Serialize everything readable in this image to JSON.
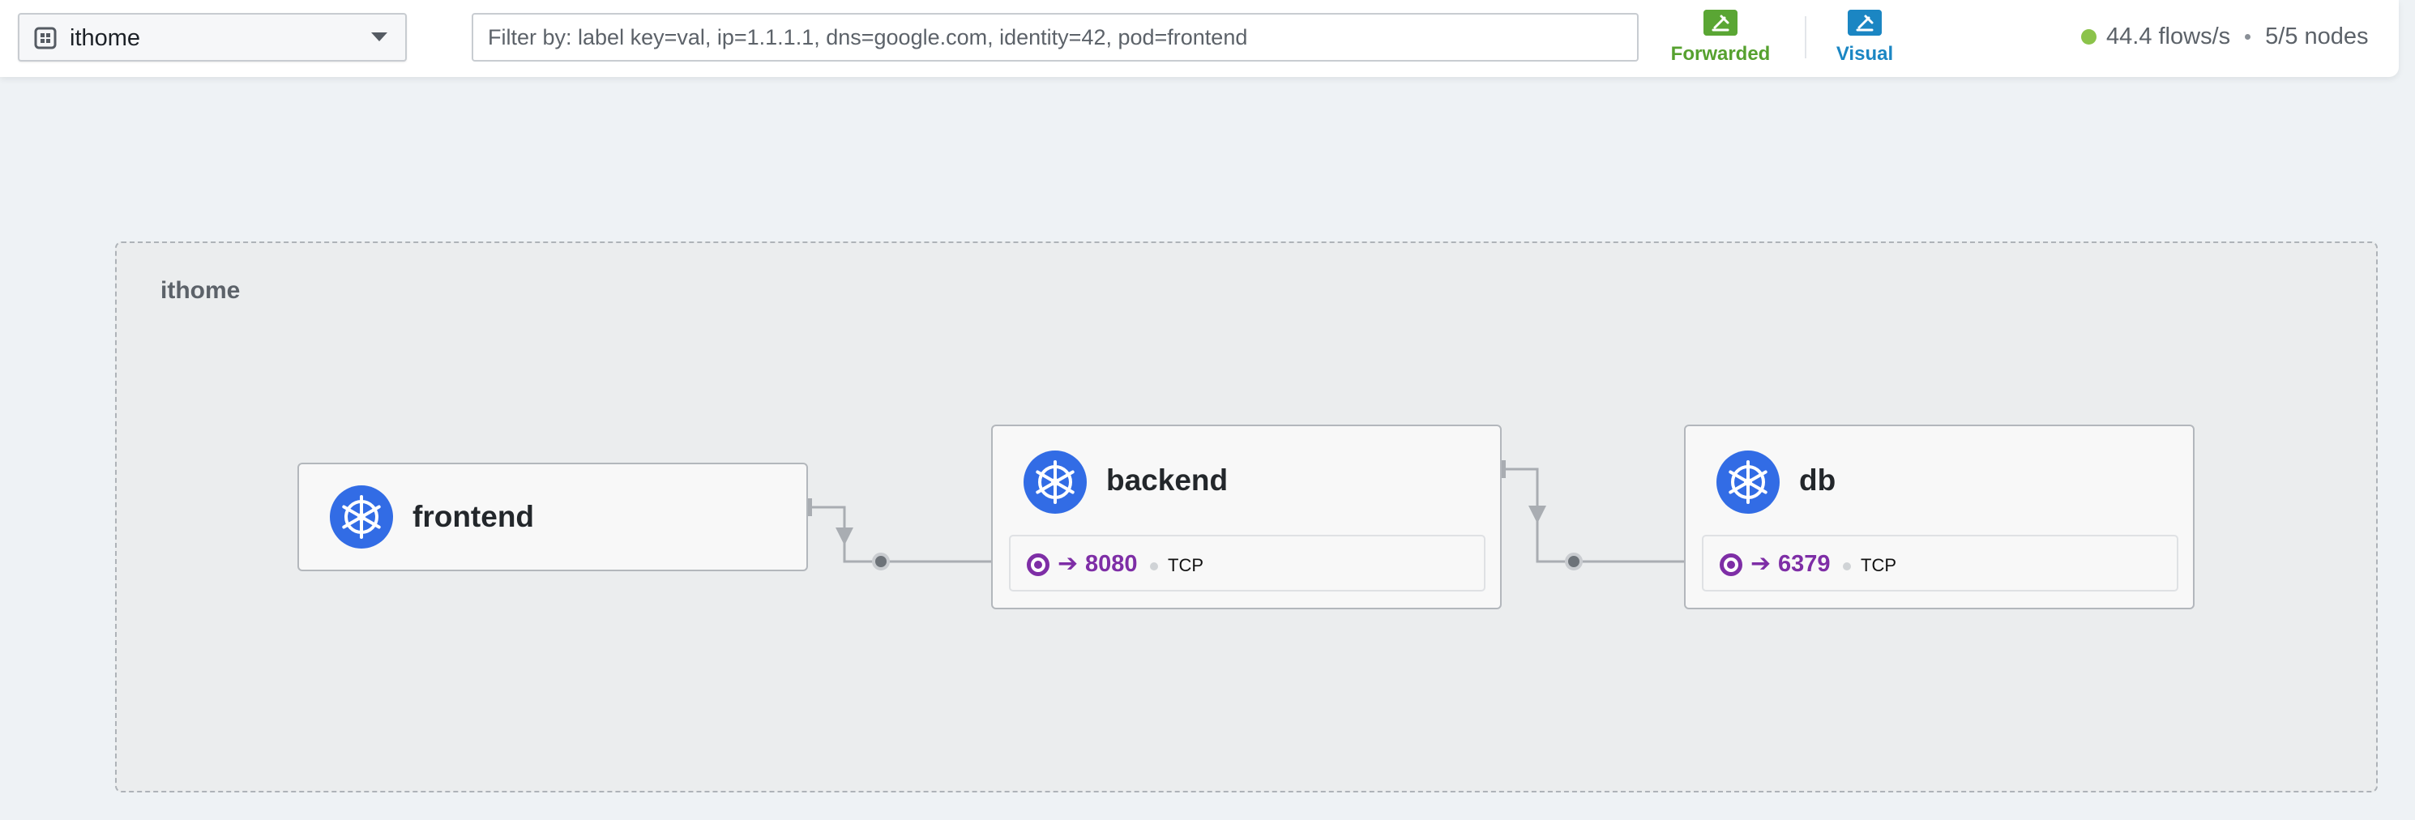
{
  "namespace_selector": {
    "selected": "ithome"
  },
  "filter": {
    "placeholder": "Filter by: label key=val, ip=1.1.1.1, dns=google.com, identity=42, pod=frontend",
    "value": ""
  },
  "verdicts": {
    "forwarded": "Forwarded",
    "visual": "Visual"
  },
  "colors": {
    "forwarded": "#5aa634",
    "visual": "#1b86c3",
    "port": "#7e2ea6",
    "kubernetes": "#326ce5",
    "live": "#8bc34a"
  },
  "stats": {
    "flows_per_sec": "44.4 flows/s",
    "nodes": "5/5 nodes"
  },
  "map": {
    "namespace_label": "ithome",
    "services": [
      {
        "name": "frontend",
        "icon": "kubernetes-icon"
      },
      {
        "name": "backend",
        "icon": "kubernetes-icon",
        "endpoint": {
          "port": "8080",
          "protocol": "TCP"
        }
      },
      {
        "name": "db",
        "icon": "kubernetes-icon",
        "endpoint": {
          "port": "6379",
          "protocol": "TCP"
        }
      }
    ],
    "links": [
      {
        "from": "frontend",
        "to": "backend",
        "port": "8080"
      },
      {
        "from": "backend",
        "to": "db",
        "port": "6379"
      }
    ]
  }
}
